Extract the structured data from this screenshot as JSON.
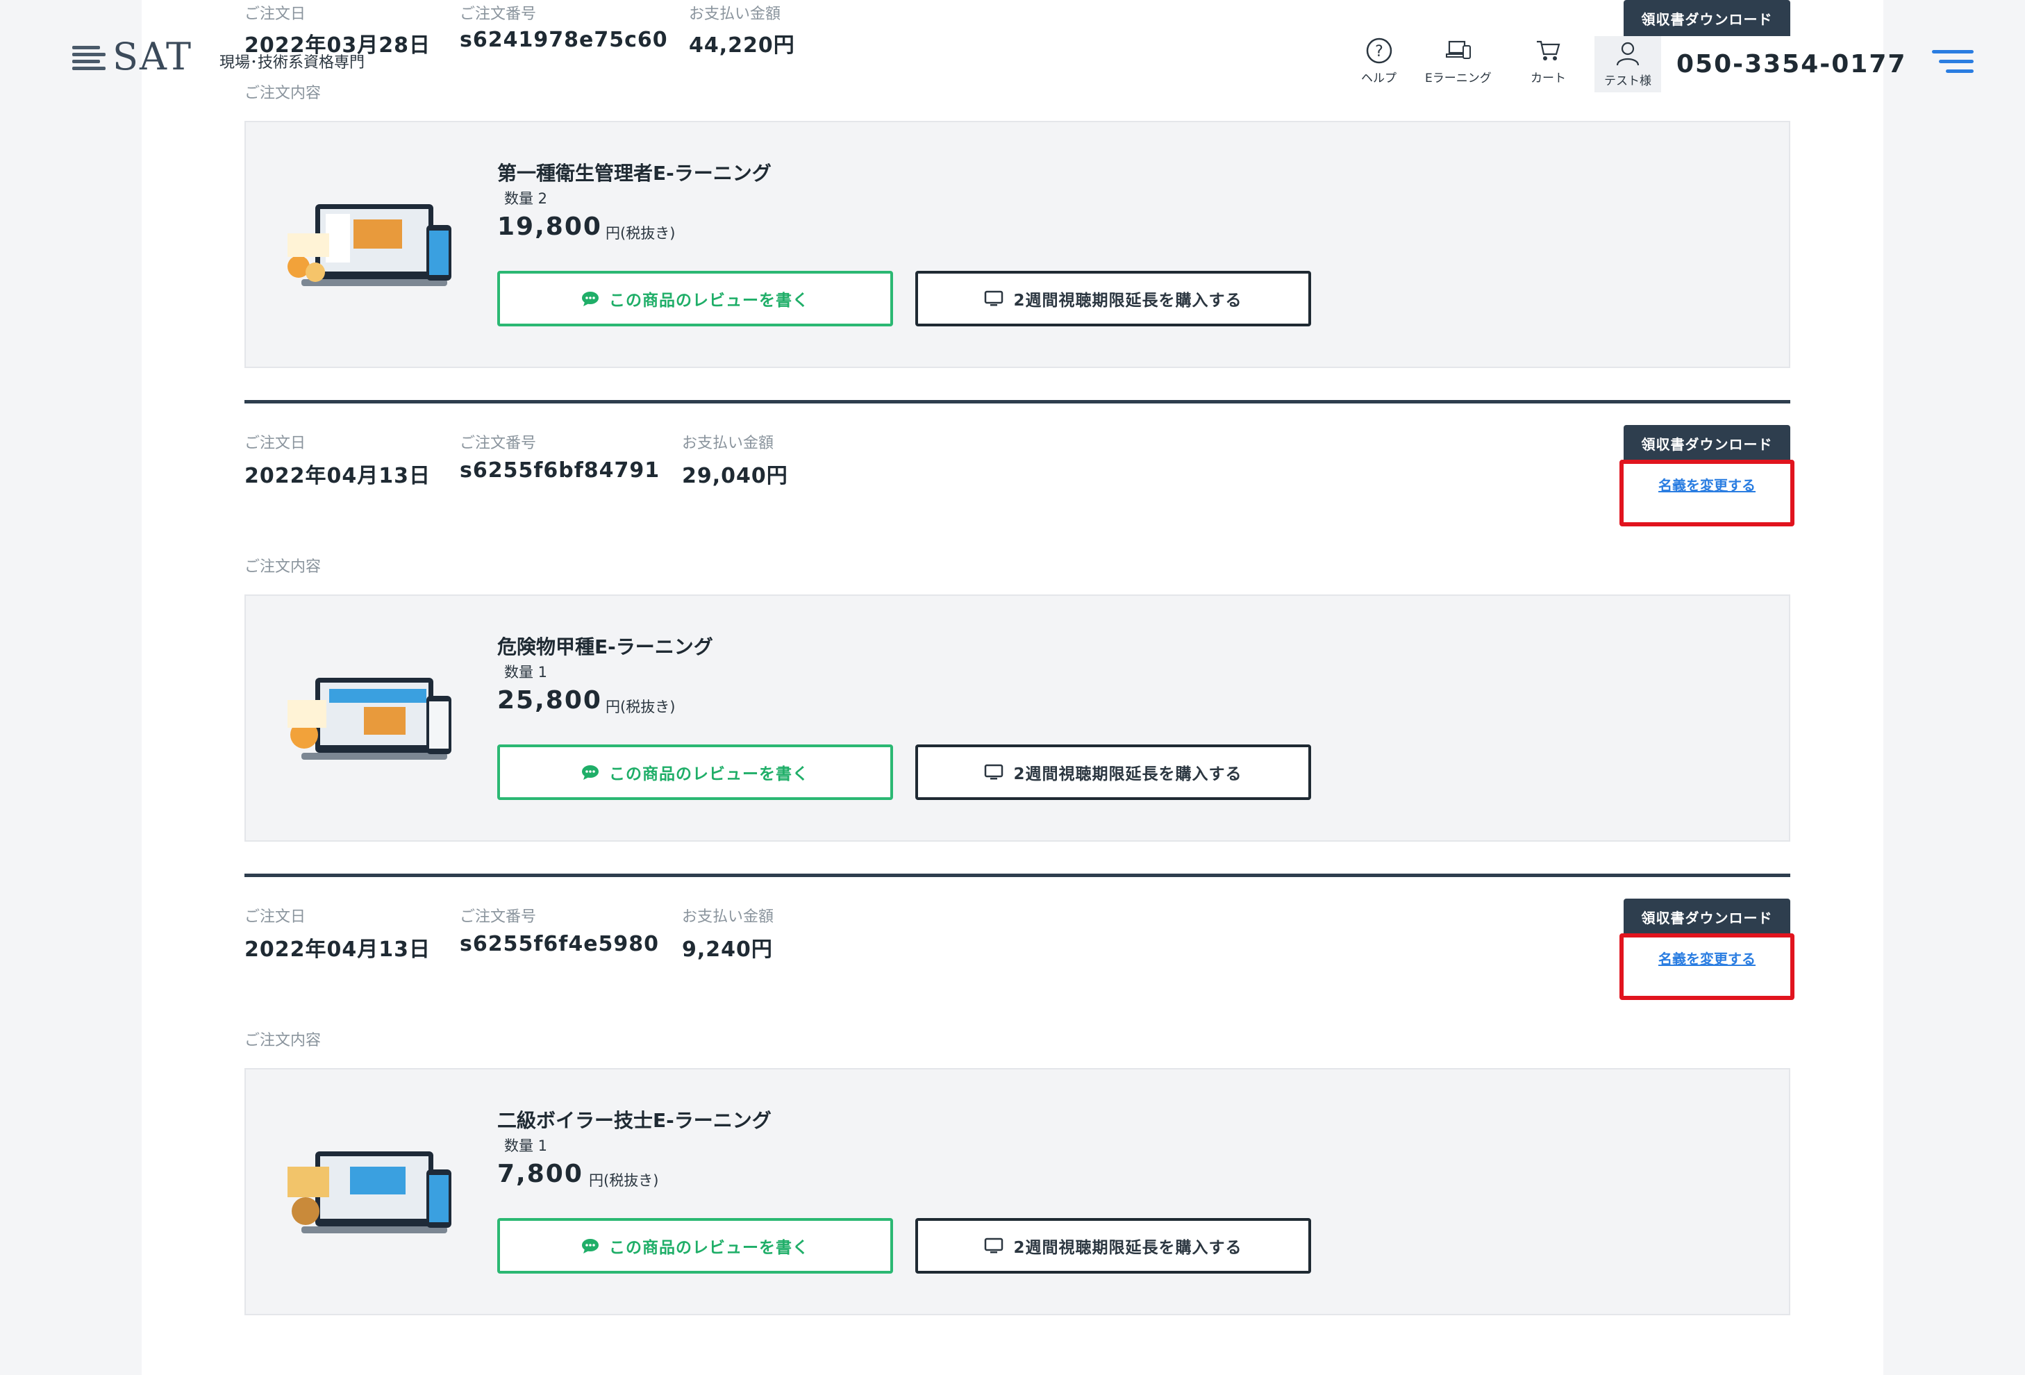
{
  "header": {
    "logo_text": "SAT",
    "logo_sub": "現場･技術系資格専門",
    "nav": [
      {
        "label": "ヘルプ",
        "icon": "help-icon"
      },
      {
        "label": "Eラーニング",
        "icon": "devices-icon"
      },
      {
        "label": "カート",
        "icon": "cart-icon"
      },
      {
        "label": "テスト様",
        "icon": "user-icon"
      }
    ],
    "phone": "050-3354-0177",
    "accent_color": "#2a7de1"
  },
  "labels": {
    "order_date": "ご注文日",
    "order_number": "ご注文番号",
    "payment_amount": "お支払い金額",
    "order_contents": "ご注文内容",
    "receipt_download": "領収書ダウンロード",
    "change_name": "名義を変更する",
    "review_button": "この商品のレビューを書く",
    "extend_button": "2週間視聴期限延長を購入する",
    "tax_excluded": "円(税抜き)"
  },
  "orders": [
    {
      "date": "2022年03月28日",
      "number": "s6241978e75c60",
      "amount": "44,220円",
      "product": {
        "name": "第一種衛生管理者E-ラーニング",
        "qty": "数量 2",
        "price": "19,800"
      }
    },
    {
      "date": "2022年04月13日",
      "number": "s6255f6bf84791",
      "amount": "29,040円",
      "product": {
        "name": "危険物甲種E-ラーニング",
        "qty": "数量 1",
        "price": "25,800"
      }
    },
    {
      "date": "2022年04月13日",
      "number": "s6255f6f4e5980",
      "amount": "9,240円",
      "product": {
        "name": "二級ボイラー技士E-ラーニング",
        "qty": "数量 1",
        "price": "7,800"
      }
    }
  ],
  "highlight_color": "#e1141e"
}
